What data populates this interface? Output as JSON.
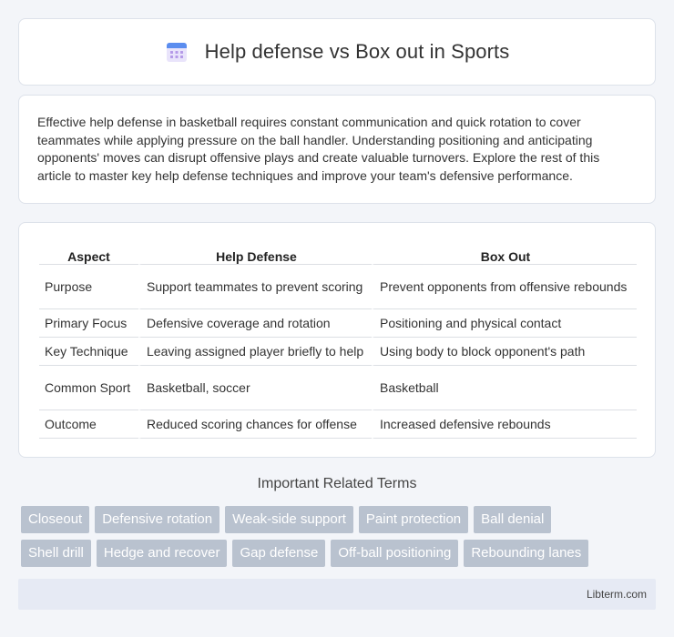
{
  "header": {
    "title": "Help defense vs Box out in Sports",
    "icon": "calendar-icon"
  },
  "intro": {
    "text": "Effective help defense in basketball requires constant communication and quick rotation to cover teammates while applying pressure on the ball handler. Understanding positioning and anticipating opponents' moves can disrupt offensive plays and create valuable turnovers. Explore the rest of this article to master key help defense techniques and improve your team's defensive performance."
  },
  "table": {
    "headers": [
      "Aspect",
      "Help Defense",
      "Box Out"
    ],
    "rows": [
      [
        "Purpose",
        "Support teammates to prevent scoring",
        "Prevent opponents from offensive rebounds"
      ],
      [
        "Primary Focus",
        "Defensive coverage and rotation",
        "Positioning and physical contact"
      ],
      [
        "Key Technique",
        "Leaving assigned player briefly to help",
        "Using body to block opponent's path"
      ],
      [
        "Common Sport",
        "Basketball, soccer",
        "Basketball"
      ],
      [
        "Outcome",
        "Reduced scoring chances for offense",
        "Increased defensive rebounds"
      ]
    ]
  },
  "related": {
    "title": "Important Related Terms",
    "row1": [
      "Closeout",
      "Defensive rotation",
      "Weak-side support",
      "Paint protection",
      "Ball denial"
    ],
    "row2": [
      "Shell drill",
      "Hedge and recover",
      "Gap defense",
      "Off-ball positioning",
      "Rebounding lanes"
    ]
  },
  "footer": {
    "text": "Libterm.com"
  },
  "colors": {
    "background": "#f3f5f9",
    "tag": "#b9c2cf",
    "footer": "#e6eaf4"
  }
}
